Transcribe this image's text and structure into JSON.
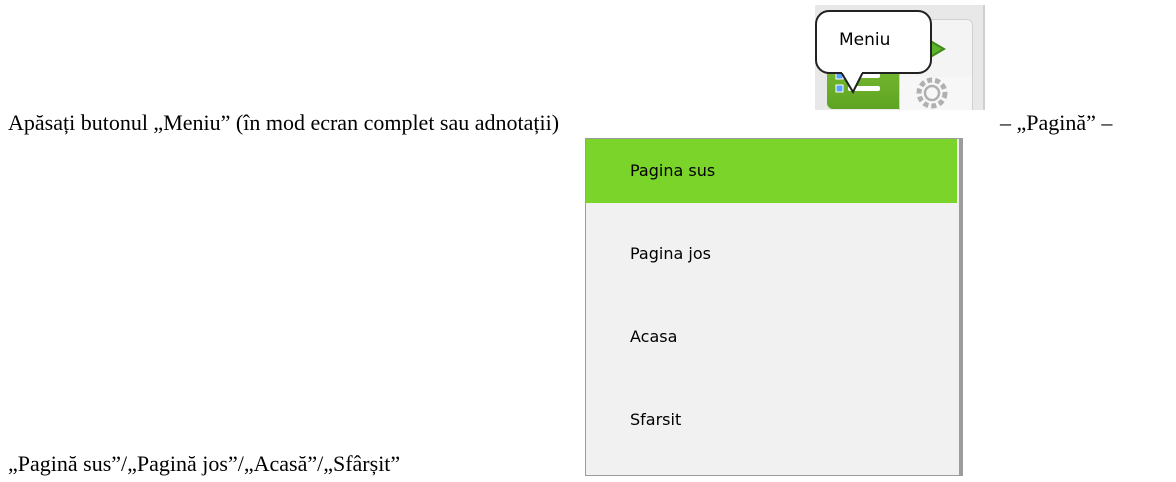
{
  "document": {
    "line1_before": "Apăsați butonul „Meniu” (în mod ecran complet sau adnotații)",
    "line1_after": "– „Pagină” –",
    "line2": "„Pagină sus”/„Pagină jos”/„Acasă”/„Sfârșit”"
  },
  "toolbar": {
    "tooltip": "Meniu",
    "icons": [
      "list-icon",
      "play-icon",
      "gear-icon"
    ],
    "accent_color": "#6ab82e"
  },
  "dropdown": {
    "items": [
      {
        "label": "Pagina sus",
        "active": true
      },
      {
        "label": "Pagina jos",
        "active": false
      },
      {
        "label": "Acasa",
        "active": false
      },
      {
        "label": "Sfarsit",
        "active": false
      }
    ],
    "active_color": "#7bd42a"
  }
}
